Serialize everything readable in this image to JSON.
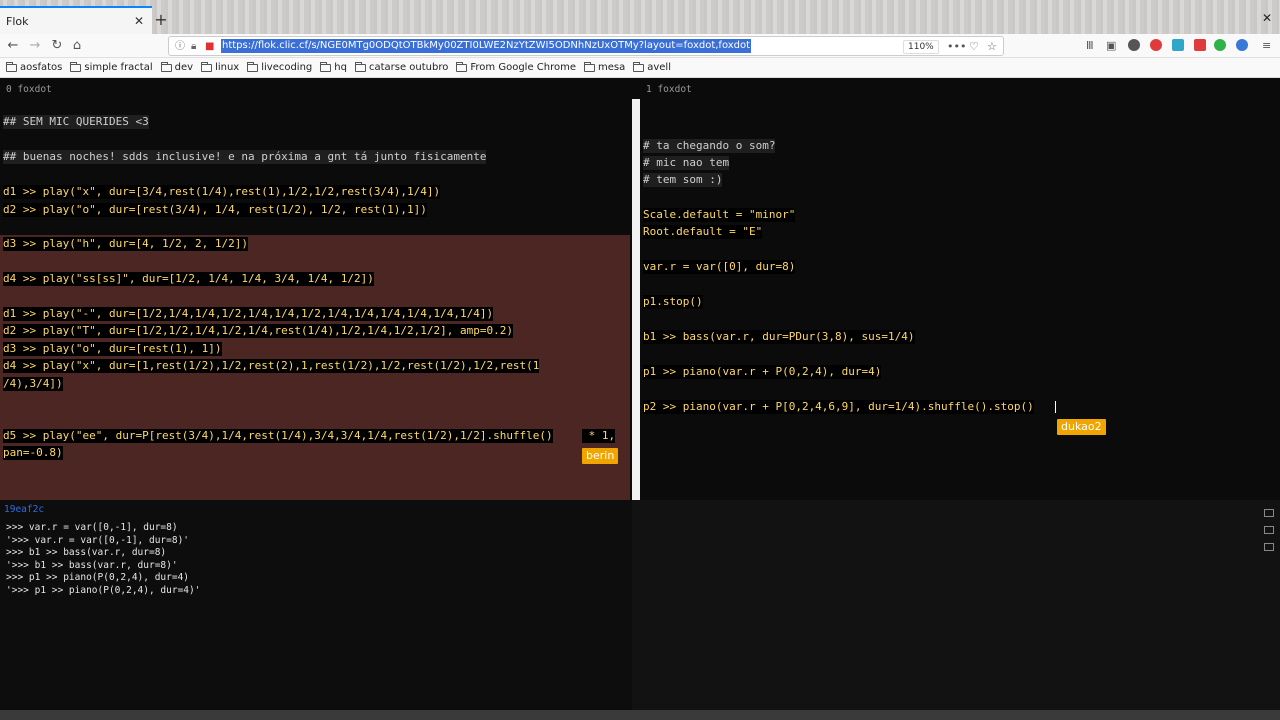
{
  "browser": {
    "tab_title": "Flok",
    "tab_close": "✕",
    "new_tab": "+",
    "window_close": "✕",
    "url": "https://flok.clic.cf/s/NGE0MTg0ODQtOTBkMy00ZTI0LWE2NzYtZWI5ODNhNzUxOTMy?layout=foxdot,foxdot",
    "zoom": "110%",
    "menu": "≡",
    "more": "•••"
  },
  "bookmarks": [
    "aosfatos",
    "simple fractal",
    "dev",
    "linux",
    "livecoding",
    "hq",
    "catarse outubro",
    "From Google Chrome",
    "mesa",
    "avell"
  ],
  "panes": {
    "left_header": "0 foxdot",
    "right_header": "1 foxdot"
  },
  "left_lines": [
    "## SEM MIC QUERIDES <3",
    "## buenas noches! sdds inclusive! e na próxima a gnt tá junto fisicamente",
    "d1 >> play(\"x\", dur=[3/4,rest(1/4),rest(1),1/2,1/2,rest(3/4),1/4])",
    "d2 >> play(\"o\", dur=[rest(3/4), 1/4, rest(1/2), 1/2, rest(1),1])",
    "d3 >> play(\"h\", dur=[4, 1/2, 2, 1/2])",
    "d4 >> play(\"ss[ss]\", dur=[1/2, 1/4, 1/4, 3/4, 1/4, 1/2])",
    "d1 >> play(\"-\", dur=[1/2,1/4,1/4,1/2,1/4,1/4,1/2,1/4,1/4,1/4,1/4,1/4,1/4])",
    "d2 >> play(\"T\", dur=[1/2,1/2,1/4,1/2,1/4,rest(1/4),1/2,1/4,1/2,1/2], amp=0.2)",
    "d3 >> play(\"o\", dur=[rest(1), 1])",
    "d4 >> play(\"x\", dur=[1,rest(1/2),1/2,rest(2),1,rest(1/2),1/2,rest(1/2),1/2,rest(1",
    "/4),3/4])",
    "d5 >> play(\"ee\", dur=P[rest(3/4),1/4,rest(1/4),3/4,3/4,1/4,rest(1/2),1/2].shuffle()",
    " * 1,",
    "pan=-0.8)"
  ],
  "right_lines": [
    "# ta chegando o som?",
    "# mic nao tem",
    "# tem som :)",
    "Scale.default = \"minor\"",
    "Root.default = \"E\"",
    "var.r = var([0], dur=8)",
    "p1.stop()",
    "b1 >> bass(var.r, dur=PDur(3,8), sus=1/4)",
    "p1 >> piano(var.r + P(0,2,4), dur=4)",
    "p2 >> piano(var.r + P[0,2,4,6,9], dur=1/4).shuffle().stop()"
  ],
  "users": {
    "left_cursor": "berin",
    "right_cursor": "dukao2"
  },
  "console": {
    "id": "19eaf2c",
    "lines": [
      ">>> var.r = var([0,-1], dur=8)",
      "'>>> var.r = var([0,-1], dur=8)'",
      ">>> b1 >> bass(var.r, dur=8)",
      "'>>> b1 >> bass(var.r, dur=8)'",
      ">>> p1 >> piano(P(0,2,4), dur=4)",
      "'>>> p1 >> piano(P(0,2,4), dur=4)'"
    ]
  }
}
